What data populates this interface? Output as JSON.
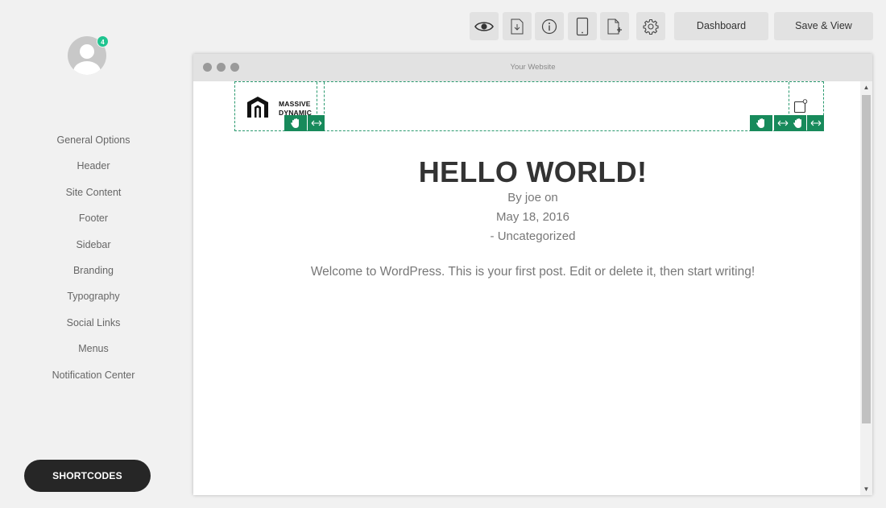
{
  "user": {
    "notification_count": "4"
  },
  "sidebar": {
    "items": [
      {
        "label": "General Options"
      },
      {
        "label": "Header"
      },
      {
        "label": "Site Content"
      },
      {
        "label": "Footer"
      },
      {
        "label": "Sidebar"
      },
      {
        "label": "Branding"
      },
      {
        "label": "Typography"
      },
      {
        "label": "Social Links"
      },
      {
        "label": "Menus"
      },
      {
        "label": "Notification Center"
      }
    ],
    "shortcodes_label": "SHORTCODES"
  },
  "toolbar": {
    "icons": [
      "eye-icon",
      "import-icon",
      "info-icon",
      "tablet-icon",
      "new-page-icon",
      "gear-icon"
    ],
    "dashboard_label": "Dashboard",
    "save_view_label": "Save & View"
  },
  "browser": {
    "title": "Your Website"
  },
  "site": {
    "logo_line1": "MASSIVE",
    "logo_line2": "DYNAMIC"
  },
  "post": {
    "title": "HELLO WORLD!",
    "byline": "By joe on",
    "date": "May 18, 2016",
    "category": "- Uncategorized",
    "body": "Welcome to WordPress. This is your first post. Edit or delete it, then start writing!"
  },
  "colors": {
    "accent_green": "#178a5b",
    "badge_green": "#1fc48f",
    "dark_button": "#262626"
  }
}
